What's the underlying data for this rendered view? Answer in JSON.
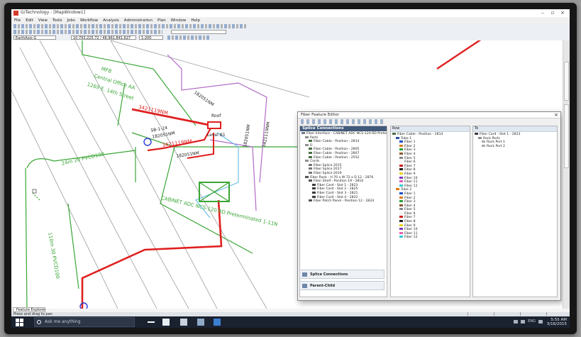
{
  "window": {
    "title": "G/Technology - [MapWindow1]",
    "controls": [
      "–",
      "▫",
      "×"
    ]
  },
  "menu": [
    "File",
    "Edit",
    "View",
    "Tools",
    "Jobs",
    "Workflow",
    "Analysis",
    "Administration",
    "Plan",
    "Window",
    "Help"
  ],
  "toolbar": {
    "layer_select": "EarthAxis G",
    "coordinates": "10,793,225.72 / 46,961,841.627",
    "zoom": "1:200"
  },
  "map": {
    "labels": {
      "mfb": "MFB",
      "central_office": "Central Office AA",
      "street": "1269 E. 14th Street",
      "cable1": "3421119NM",
      "cable2": "182051NM",
      "roof": "Roof",
      "level": "Level B1",
      "sb": "SB-1-24",
      "spl": "182051NM",
      "cable3": "3421119NM",
      "cable4": "182051NM",
      "cable5": "182051NM",
      "cable6": "3421119NM",
      "duct1": "24m 20 PVCD100",
      "duct2": "110m 30 PVCD100",
      "cabinet": "CABINET ADC NCS-120 RD Preterminated 1-11N"
    }
  },
  "dialog": {
    "title": "Fiber Feature Editor",
    "left": {
      "header": "Splice Connections",
      "nodes": [
        {
          "text": "Fiber Interface - CABINET ADC NCS-120 RD Preterm",
          "lvl": 0,
          "icon": "#6d7c8a"
        },
        {
          "text": "Ports",
          "lvl": 1,
          "icon": "#8f8f8f"
        },
        {
          "text": "Fiber Cable - Position - 2814",
          "lvl": 2,
          "icon": "#4b6f44"
        },
        {
          "text": "Fi",
          "lvl": 1,
          "icon": "#8f8f8f"
        },
        {
          "text": "Fiber Cable - Position - 2805",
          "lvl": 2,
          "icon": "#4b6f44"
        },
        {
          "text": "Fiber Cable - Position - 2807",
          "lvl": 2,
          "icon": "#4b6f44"
        },
        {
          "text": "Fiber Cable - Position - 2552",
          "lvl": 2,
          "icon": "#4b6f44"
        },
        {
          "text": "Cords",
          "lvl": 1,
          "icon": "#8f8f8f"
        },
        {
          "text": "Fiber Splice 2015",
          "lvl": 2,
          "icon": "#777"
        },
        {
          "text": "Fiber Splice 2017",
          "lvl": 2,
          "icon": "#777"
        },
        {
          "text": "Fiber Splice 2019",
          "lvl": 2,
          "icon": "#777"
        },
        {
          "text": "Fiber Rack - H 70 x W 72 x D 12 - 2876",
          "lvl": 1,
          "icon": "#555"
        },
        {
          "text": "Fiber Shelf - Position 19 - 2816",
          "lvl": 2,
          "icon": "#555"
        },
        {
          "text": "Fiber Card - Slot 1 - 2823",
          "lvl": 3,
          "icon": "#3d3d3d"
        },
        {
          "text": "Fiber Card - Slot 2 - 2825",
          "lvl": 3,
          "icon": "#3d3d3d"
        },
        {
          "text": "Fiber Card - Slot 3 - 2821",
          "lvl": 3,
          "icon": "#3d3d3d"
        },
        {
          "text": "Fiber Card - Slot 4 - 2822",
          "lvl": 3,
          "icon": "#3d3d3d"
        },
        {
          "text": "Fiber Patch Panel - Position 12 - 2824",
          "lvl": 2,
          "icon": "#555"
        }
      ],
      "buttons": [
        "Splice Connections",
        "Parent-Child"
      ]
    },
    "mid": {
      "header": "Row",
      "top": "Fiber Cable - Position - 2814",
      "tube1": "Tube 1",
      "tube2": "Tube 2",
      "fibers_a": [
        "Fiber 1",
        "Fiber 2",
        "Fiber 3",
        "Fiber 4",
        "Fiber 5",
        "Fiber 6",
        "Fiber 7",
        "Fiber 8",
        "Fiber 9",
        "Fiber 10",
        "Fiber 11",
        "Fiber 12"
      ],
      "fibers_b": [
        "Fiber 1",
        "Fiber 2",
        "Fiber 3",
        "Fiber 4",
        "Fiber 5",
        "Fiber 6",
        "Fiber 7",
        "Fiber 8",
        "Fiber 9",
        "Fiber 10",
        "Fiber 11",
        "Fiber 12"
      ],
      "fiber_colors": [
        "#1f4fc7",
        "#e07b1a",
        "#2aa23a",
        "#8a5a2b",
        "#888888",
        "#f2f2f2",
        "#d42020",
        "#222222",
        "#e6d21c",
        "#7a3cc0",
        "#e55fb0",
        "#35c6d6"
      ]
    },
    "right": {
      "header": "To",
      "nodes": [
        {
          "text": "Fiber Card - Slot 1 - 2823",
          "lvl": 0,
          "icon": "#3d3d3d"
        },
        {
          "text": "Rock Ports",
          "lvl": 1,
          "icon": "#8f8f8f"
        },
        {
          "text": "Rock Port 1",
          "lvl": 2,
          "icon": "#aaa"
        },
        {
          "text": "Rock Port 2",
          "lvl": 2,
          "icon": "#aaa"
        }
      ]
    }
  },
  "dock": {
    "feature_tab": "Feature Explorer",
    "status": "Press and drag to pan"
  },
  "taskbar": {
    "search": "Ask me anything",
    "time": "5:55 AM",
    "date": "3/16/2015",
    "lang": "ENG"
  },
  "colors": {
    "red": "#e02020",
    "green": "#3aa635",
    "violet": "#b26ac7",
    "cyan": "#6ec1ea",
    "dark": "#222"
  }
}
